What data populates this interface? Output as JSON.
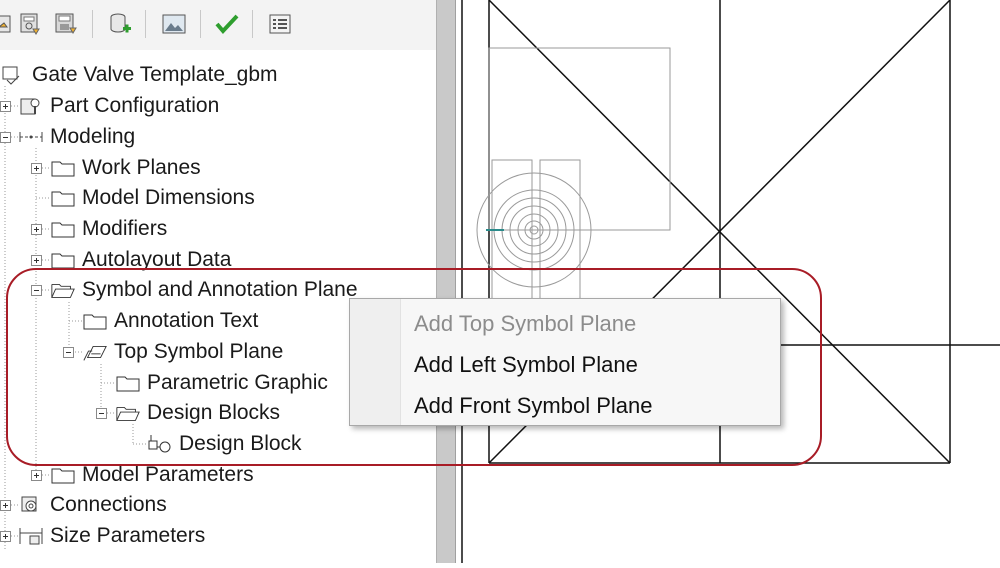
{
  "toolbar": {
    "buttons": [
      {
        "icon": "open-template-icon"
      },
      {
        "icon": "check-in-icon"
      },
      {
        "icon": "save-template-icon"
      },
      {
        "icon": "add-database-icon"
      },
      {
        "icon": "image-icon"
      },
      {
        "icon": "checkmark-icon"
      },
      {
        "icon": "properties-icon"
      }
    ]
  },
  "tree": {
    "root": "Gate Valve Template_gbm",
    "items": [
      {
        "label": "Part Configuration"
      },
      {
        "label": "Modeling"
      },
      {
        "label": "Work Planes"
      },
      {
        "label": "Model Dimensions"
      },
      {
        "label": "Modifiers"
      },
      {
        "label": "Autolayout Data"
      },
      {
        "label": "Symbol and Annotation Plane"
      },
      {
        "label": "Annotation Text"
      },
      {
        "label": "Top Symbol Plane"
      },
      {
        "label": "Parametric Graphic"
      },
      {
        "label": "Design Blocks"
      },
      {
        "label": "Design Block"
      },
      {
        "label": "Model Parameters"
      },
      {
        "label": "Connections"
      },
      {
        "label": "Size Parameters"
      }
    ]
  },
  "context_menu": {
    "items": [
      {
        "label": "Add Top Symbol Plane",
        "enabled": false
      },
      {
        "label": "Add Left Symbol Plane",
        "enabled": true
      },
      {
        "label": "Add Front Symbol Plane",
        "enabled": true
      }
    ]
  },
  "colors": {
    "highlight": "#a81c26",
    "check": "#2e9e2e"
  }
}
